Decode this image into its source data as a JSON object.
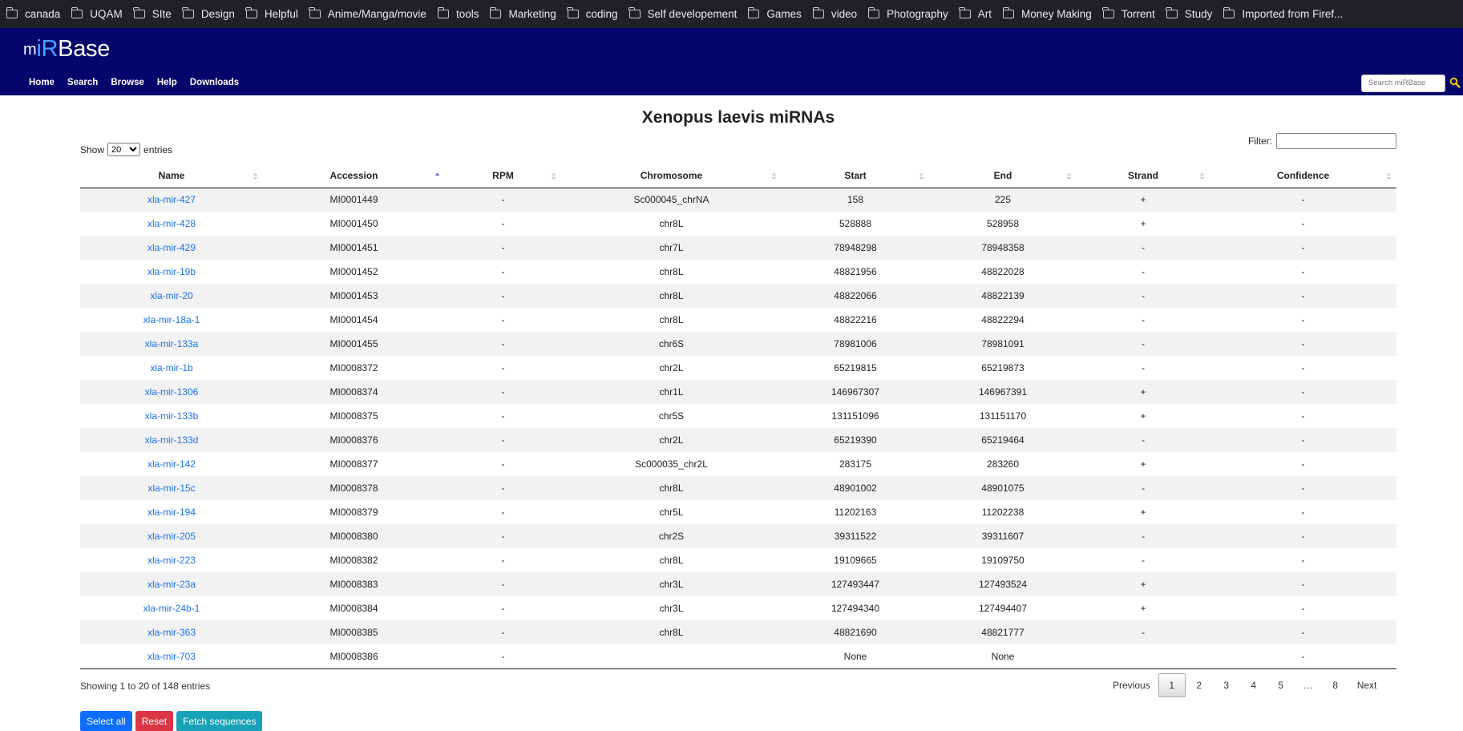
{
  "bookmarks": [
    "canada",
    "UQAM",
    "SIte",
    "Design",
    "Helpful",
    "Anime/Manga/movie",
    "tools",
    "Marketing",
    "coding",
    "Self developement",
    "Games",
    "video",
    "Photography",
    "Art",
    "Money Making",
    "Torrent",
    "Study",
    "Imported from Firef..."
  ],
  "header": {
    "logo_m": "m",
    "logo_ir": "iR",
    "logo_base": "Base",
    "nav": [
      "Home",
      "Search",
      "Browse",
      "Help",
      "Downloads"
    ],
    "search_placeholder": "Search miRBase",
    "colors": {
      "background": "#04066b",
      "accent": "#4ca0ff",
      "search_icon": "#f5c400"
    }
  },
  "page_title": "Xenopus laevis miRNAs",
  "controls": {
    "show_label": "Show",
    "entries_value": "20",
    "entries_label": "entries",
    "filter_label": "Filter:",
    "filter_value": ""
  },
  "table": {
    "headers": [
      "Name",
      "Accession",
      "RPM",
      "Chromosome",
      "Start",
      "End",
      "Strand",
      "Confidence"
    ],
    "sorted_column": "Accession",
    "rows": [
      [
        "xla-mir-427",
        "MI0001449",
        "-",
        "Sc000045_chrNA",
        "158",
        "225",
        "+",
        "-"
      ],
      [
        "xla-mir-428",
        "MI0001450",
        "-",
        "chr8L",
        "528888",
        "528958",
        "+",
        "-"
      ],
      [
        "xla-mir-429",
        "MI0001451",
        "-",
        "chr7L",
        "78948298",
        "78948358",
        "-",
        "-"
      ],
      [
        "xla-mir-19b",
        "MI0001452",
        "-",
        "chr8L",
        "48821956",
        "48822028",
        "-",
        "-"
      ],
      [
        "xla-mir-20",
        "MI0001453",
        "-",
        "chr8L",
        "48822066",
        "48822139",
        "-",
        "-"
      ],
      [
        "xla-mir-18a-1",
        "MI0001454",
        "-",
        "chr8L",
        "48822216",
        "48822294",
        "-",
        "-"
      ],
      [
        "xla-mir-133a",
        "MI0001455",
        "-",
        "chr6S",
        "78981006",
        "78981091",
        "-",
        "-"
      ],
      [
        "xla-mir-1b",
        "MI0008372",
        "-",
        "chr2L",
        "65219815",
        "65219873",
        "-",
        "-"
      ],
      [
        "xla-mir-1306",
        "MI0008374",
        "-",
        "chr1L",
        "146967307",
        "146967391",
        "+",
        "-"
      ],
      [
        "xla-mir-133b",
        "MI0008375",
        "-",
        "chr5S",
        "131151096",
        "131151170",
        "+",
        "-"
      ],
      [
        "xla-mir-133d",
        "MI0008376",
        "-",
        "chr2L",
        "65219390",
        "65219464",
        "-",
        "-"
      ],
      [
        "xla-mir-142",
        "MI0008377",
        "-",
        "Sc000035_chr2L",
        "283175",
        "283260",
        "+",
        "-"
      ],
      [
        "xla-mir-15c",
        "MI0008378",
        "-",
        "chr8L",
        "48901002",
        "48901075",
        "-",
        "-"
      ],
      [
        "xla-mir-194",
        "MI0008379",
        "-",
        "chr5L",
        "11202163",
        "11202238",
        "+",
        "-"
      ],
      [
        "xla-mir-205",
        "MI0008380",
        "-",
        "chr2S",
        "39311522",
        "39311607",
        "-",
        "-"
      ],
      [
        "xla-mir-223",
        "MI0008382",
        "-",
        "chr8L",
        "19109665",
        "19109750",
        "-",
        "-"
      ],
      [
        "xla-mir-23a",
        "MI0008383",
        "-",
        "chr3L",
        "127493447",
        "127493524",
        "+",
        "-"
      ],
      [
        "xla-mir-24b-1",
        "MI0008384",
        "-",
        "chr3L",
        "127494340",
        "127494407",
        "+",
        "-"
      ],
      [
        "xla-mir-363",
        "MI0008385",
        "-",
        "chr8L",
        "48821690",
        "48821777",
        "-",
        "-"
      ],
      [
        "xla-mir-703",
        "MI0008386",
        "-",
        "",
        "None",
        "None",
        "",
        "-"
      ]
    ]
  },
  "footer": {
    "info": "Showing 1 to 20 of 148 entries",
    "pagination": [
      "Previous",
      "1",
      "2",
      "3",
      "4",
      "5",
      "…",
      "8",
      "Next"
    ],
    "current_page": "1",
    "buttons": [
      "Select all",
      "Reset",
      "Fetch sequences"
    ]
  }
}
